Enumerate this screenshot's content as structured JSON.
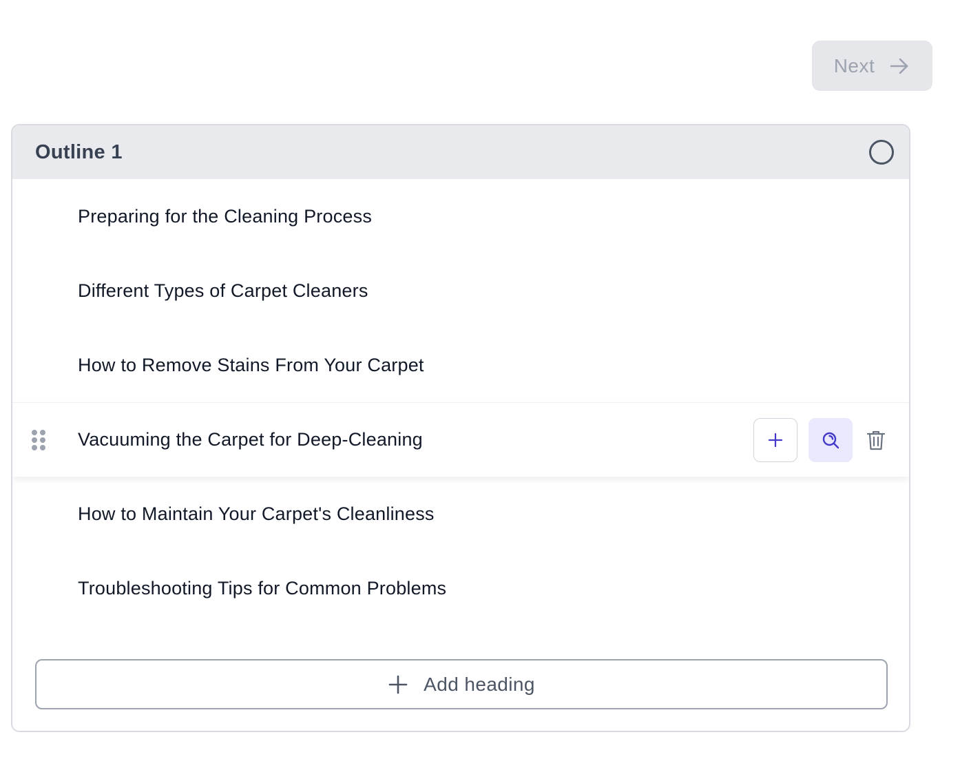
{
  "toolbar": {
    "next_label": "Next",
    "next_icon": "arrow-right-icon"
  },
  "outline": {
    "title": "Outline 1",
    "select_icon": "radio-circle-icon",
    "headings": [
      {
        "label": "Preparing for the Cleaning Process"
      },
      {
        "label": "Different Types of Carpet Cleaners"
      },
      {
        "label": "How to Remove Stains From Your Carpet"
      },
      {
        "label": "Vacuuming the Carpet for Deep-Cleaning",
        "active": true
      },
      {
        "label": "How to Maintain Your Carpet's Cleanliness"
      },
      {
        "label": "Troubleshooting Tips for Common Problems"
      }
    ],
    "row_actions": {
      "add_icon": "plus-icon",
      "research_icon": "search-icon",
      "delete_icon": "trash-icon",
      "drag_icon": "drag-handle-icon"
    },
    "add_heading_label": "Add heading",
    "add_heading_icon": "plus-icon"
  },
  "colors": {
    "accent": "#4338ca",
    "accent_bg": "#e9e8fc",
    "header_bg": "#e9eaee",
    "disabled_bg": "#e5e7eb",
    "disabled_text": "#9ca3af"
  }
}
